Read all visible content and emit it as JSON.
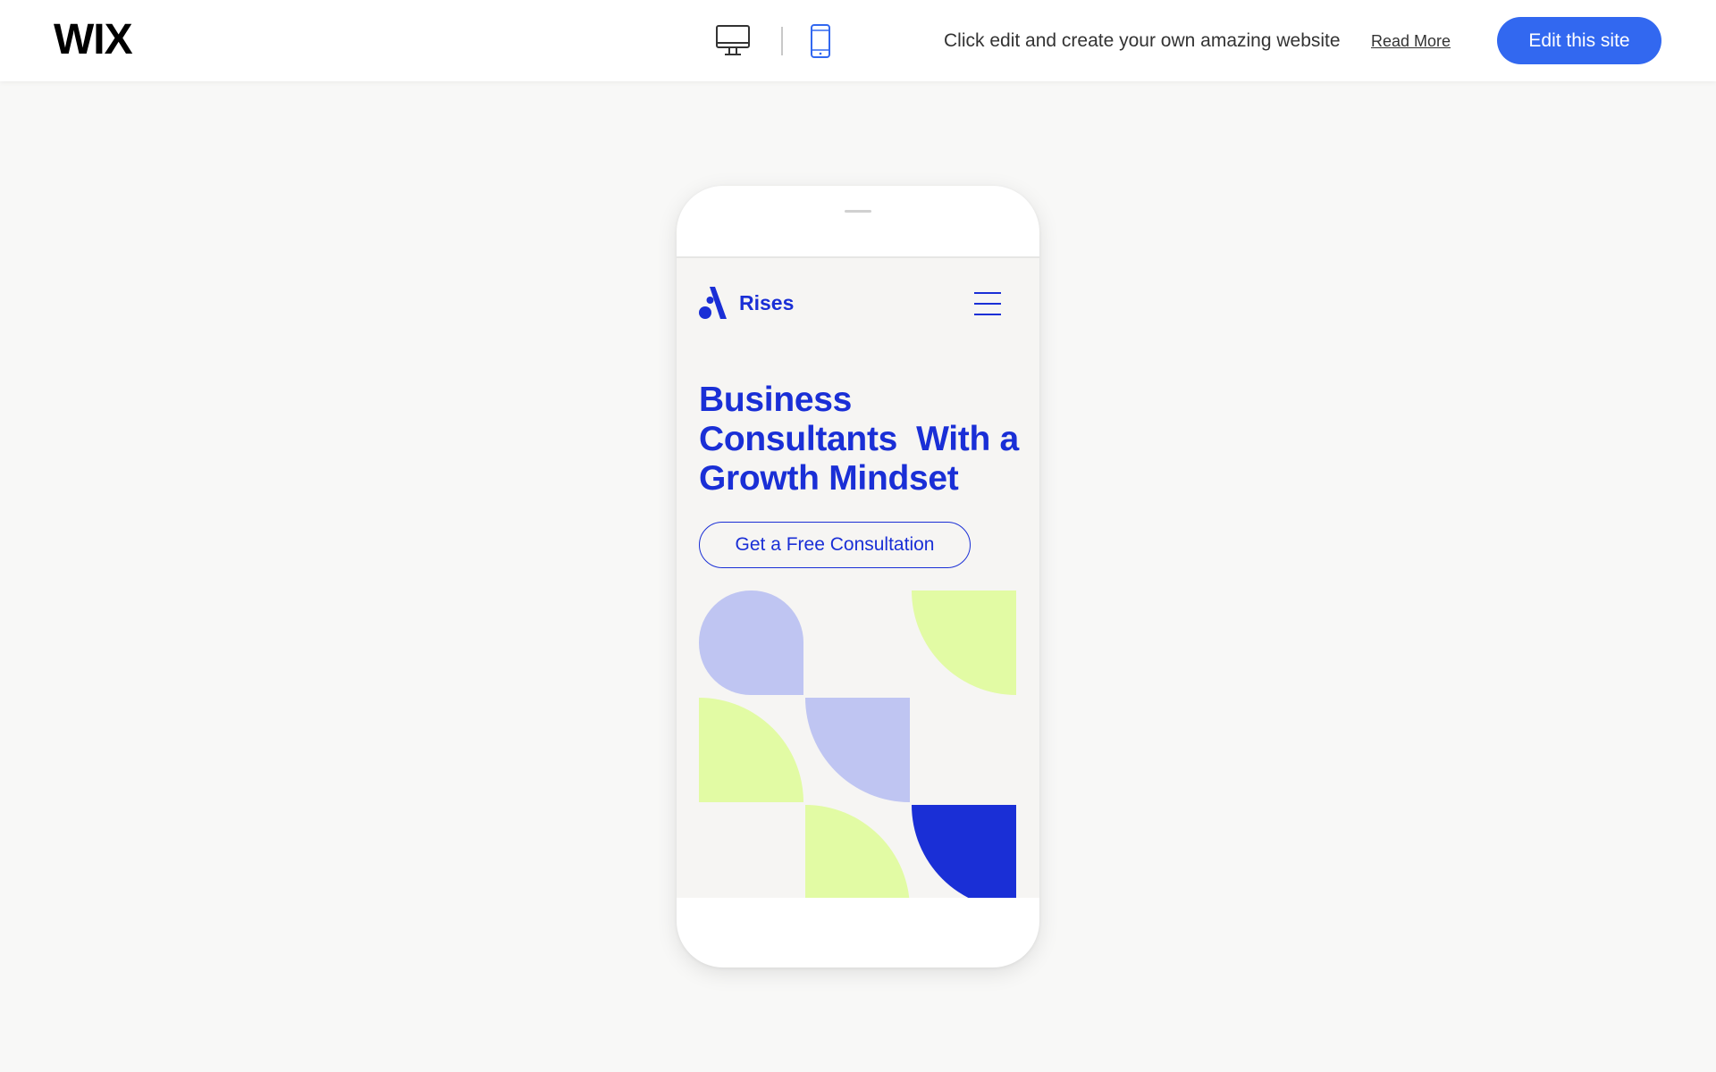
{
  "topbar": {
    "logo": "WIX",
    "promo_text": "Click edit and create your own amazing website",
    "read_more": "Read More",
    "edit_button": "Edit this site",
    "view_selected": "mobile"
  },
  "site": {
    "brand": "Rises",
    "hero_lines": [
      "Business",
      "Consultants  With a",
      "Growth Mindset"
    ],
    "cta": "Get a Free Consultation"
  },
  "colors": {
    "accent_button": "#3268f0",
    "brand_blue": "#1a2fd6",
    "lavender": "#bfc5f2",
    "lime": "#e2fba4",
    "screen_bg": "#f6f5f3"
  }
}
